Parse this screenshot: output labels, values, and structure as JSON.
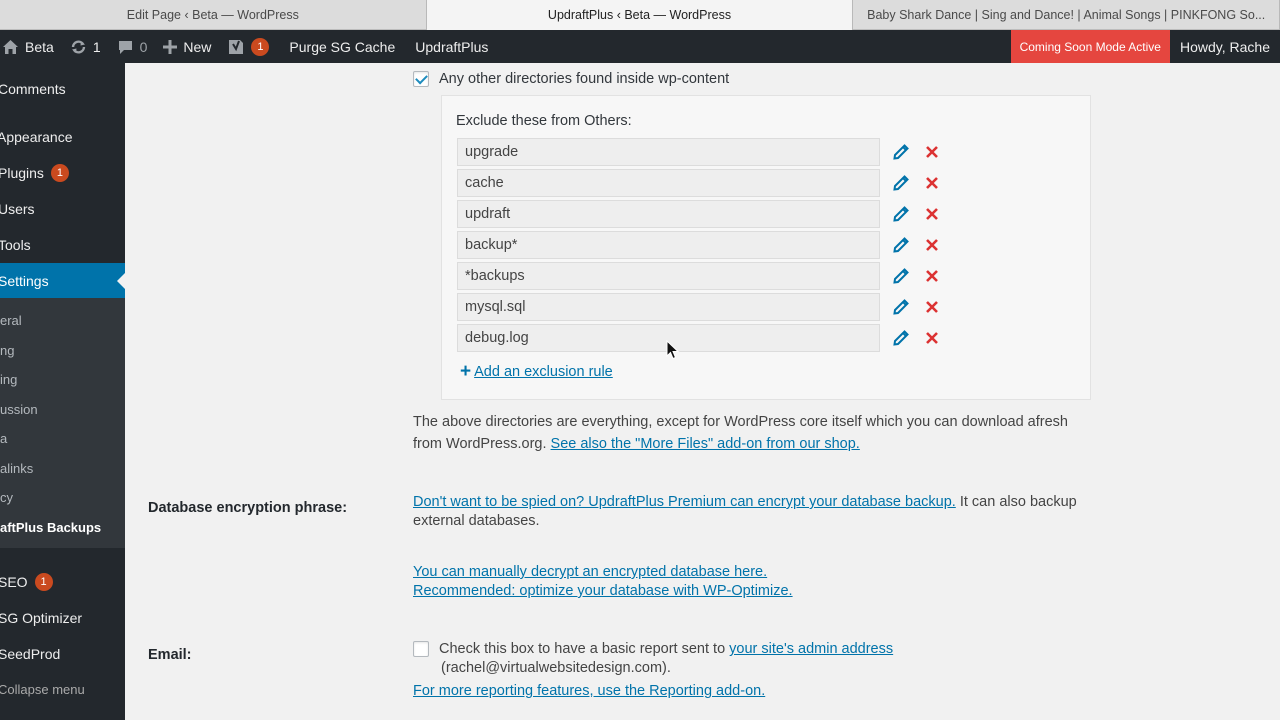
{
  "browser": {
    "tabs": [
      {
        "title": "Edit Page ‹ Beta — WordPress",
        "active": false
      },
      {
        "title": "UpdraftPlus ‹ Beta — WordPress",
        "active": true
      },
      {
        "title": "Baby Shark Dance | Sing and Dance! | Animal Songs | PINKFONG So...",
        "active": false
      }
    ]
  },
  "adminbar": {
    "site_name": "Beta",
    "updates_count": "1",
    "comments_count": "0",
    "new_label": "New",
    "yoast_count": "1",
    "purge_label": "Purge SG Cache",
    "updraft_label": "UpdraftPlus",
    "coming_soon_label": "Coming Soon Mode Active",
    "howdy_label": "Howdy, Rache"
  },
  "sidebar": {
    "items": [
      {
        "label": "Comments",
        "count": null
      },
      {
        "label": "Appearance",
        "count": null
      },
      {
        "label": "Plugins",
        "count": "1"
      },
      {
        "label": "Users",
        "count": null
      },
      {
        "label": "Tools",
        "count": null
      },
      {
        "label": "Settings",
        "count": null,
        "current": true
      }
    ],
    "submenu": [
      "eral",
      "ng",
      "ing",
      "ussion",
      "a",
      "alinks",
      "cy",
      "aftPlus Backups"
    ],
    "bottom_items": [
      {
        "label": "SEO",
        "count": "1"
      },
      {
        "label": "SG Optimizer",
        "count": null
      },
      {
        "label": "SeedProd",
        "count": null
      }
    ],
    "collapse_label": "Collapse menu"
  },
  "content": {
    "other_dirs_label": "Any other directories found inside wp-content",
    "other_dirs_checked": true,
    "exclude_title": "Exclude these from Others:",
    "rules": [
      "upgrade",
      "cache",
      "updraft",
      "backup*",
      "*backups",
      "mysql.sql",
      "debug.log"
    ],
    "add_rule_label": "Add an exclusion rule",
    "dirs_desc": "The above directories are everything, except for WordPress core itself which you can download afresh from WordPress.org.",
    "more_files_link": "See also the \"More Files\" add-on from our shop.",
    "db_label": "Database encryption phrase:",
    "db_premium_link": "Don't want to be spied on? UpdraftPlus Premium can encrypt your database backup.",
    "db_desc_tail": "It can also backup external databases.",
    "decrypt_link": "You can manually decrypt an encrypted database here.",
    "optimize_link": "Recommended: optimize your database with WP-Optimize.",
    "email_label": "Email:",
    "email_checkbox_text": "Check this box to have a basic report sent to",
    "email_admin_link": "your site's admin address",
    "email_address": "(rachel@virtualwebsitedesign.com).",
    "reporting_link": "For more reporting features, use the Reporting add-on."
  },
  "colors": {
    "admin_bar": "#23282d",
    "accent": "#0073aa",
    "coming_soon": "#e5463f",
    "delete": "#dc3232"
  }
}
